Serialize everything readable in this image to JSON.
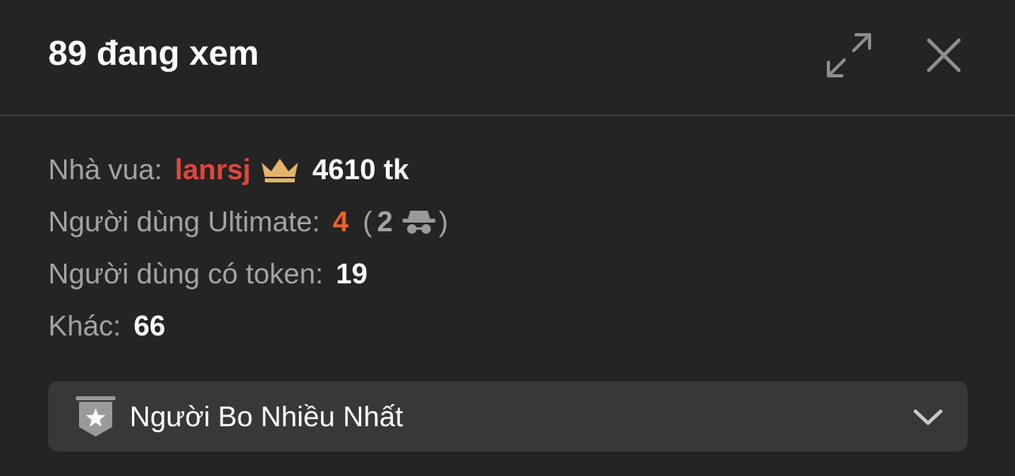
{
  "header": {
    "title": "89 đang xem",
    "expand_icon": "expand-arrows-icon",
    "close_icon": "close-icon"
  },
  "stats": {
    "king": {
      "label": "Nhà vua:",
      "username": "lanrsj",
      "icon": "crown-icon",
      "tokens": "4610 tk"
    },
    "ultimate": {
      "label": "Người dùng Ultimate:",
      "count": "4",
      "open_paren": "(",
      "anonymous_count": "2",
      "anonymous_icon": "incognito-icon",
      "close_paren": ")"
    },
    "token_users": {
      "label": "Người dùng có token:",
      "count": "19"
    },
    "others": {
      "label": "Khác:",
      "count": "66"
    }
  },
  "dropdown": {
    "label": "Người Bo Nhiều Nhất",
    "icon": "star-badge-icon",
    "chevron_icon": "chevron-down-icon"
  },
  "colors": {
    "background": "#242424",
    "divider": "#3b3b3b",
    "muted_text": "#a3a3a3",
    "king_red": "#e0473b",
    "ultimate_orange": "#e8622c",
    "crown_gold": "#e2b46a",
    "dropdown_bg": "#383838"
  }
}
